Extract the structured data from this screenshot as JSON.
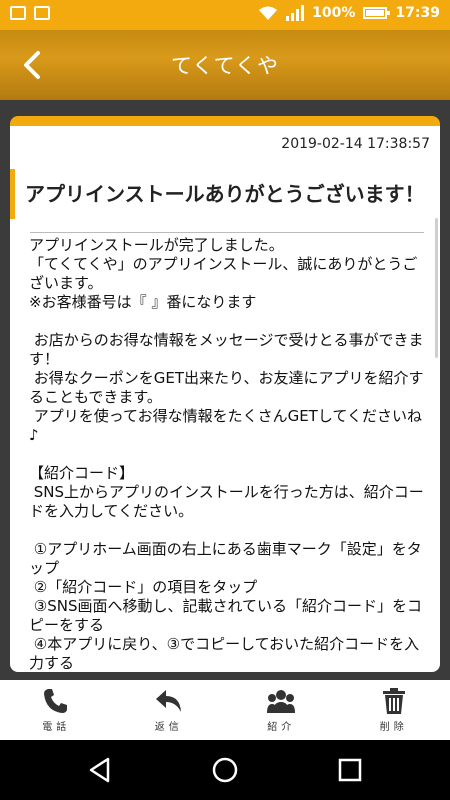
{
  "status_bar": {
    "battery": "100%",
    "time": "17:39"
  },
  "header": {
    "title": "てくてくや"
  },
  "message": {
    "date": "2019-02-14 17:38:57",
    "title": "アプリインストールありがとうございます！",
    "body": "アプリインストールが完了しました。\n「てくてくや」のアプリインストール、誠にありがとうございます。\n※お客様番号は『 』番になります\n\n お店からのお得な情報をメッセージで受けとる事ができます！\n お得なクーポンをGET出来たり、お友達にアプリを紹介することもできます。\n アプリを使ってお得な情報をたくさんGETしてくださいね♪\n\n【紹介コード】\n SNS上からアプリのインストールを行った方は、紹介コードを入力してください。\n\n ①アプリホーム画面の右上にある歯車マーク「設定」をタップ\n ②「紹介コード」の項目をタップ\n ③SNS画面へ移動し、記載されている「紹介コード」をコピーをする\n ④本アプリに戻り、③でコピーしておいた紹介コードを入力する"
  },
  "toolbar": {
    "phone_label": "電話",
    "reply_label": "返信",
    "introduce_label": "紹介",
    "delete_label": "削除"
  },
  "colors": {
    "accent": "#f2aa0e",
    "header": "#c78b12"
  }
}
